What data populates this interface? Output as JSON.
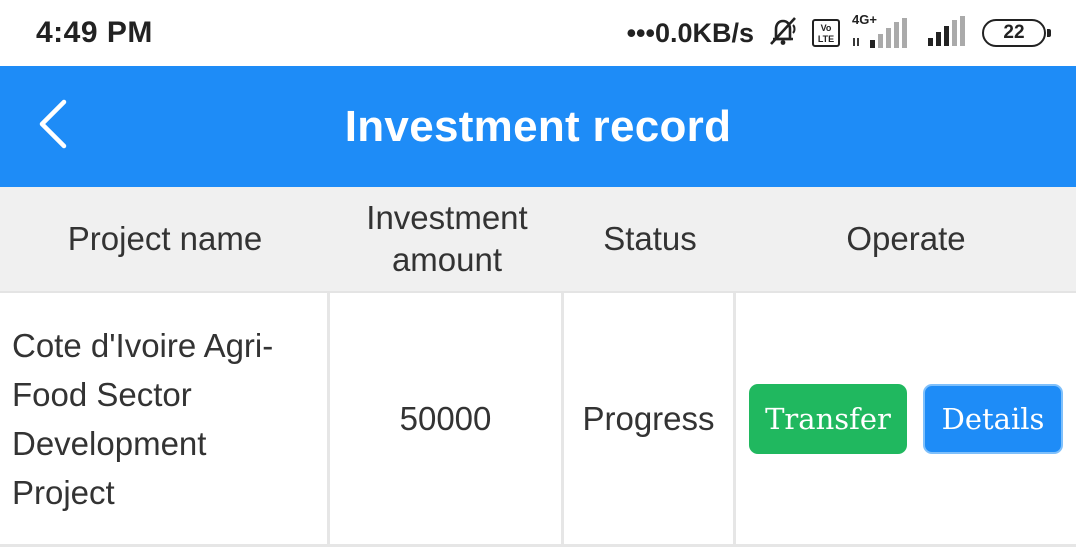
{
  "status_bar": {
    "time": "4:49 PM",
    "speed": "•••0.0KB/s",
    "volte_line1": "Vo",
    "volte_line2": "LTE",
    "network": "4G+",
    "battery": "22"
  },
  "header": {
    "title": "Investment record"
  },
  "table": {
    "headers": [
      "Project name",
      "Investment amount",
      "Status",
      "Operate"
    ],
    "rows": [
      {
        "project_name": "Cote d'Ivoire Agri-Food Sector Development Project",
        "amount": "50000",
        "status": "Progress",
        "actions": [
          "Transfer",
          "Details"
        ]
      }
    ]
  },
  "colors": {
    "primary": "#1e8cf7",
    "success": "#20b85f",
    "header_bg": "#f0f0f0"
  }
}
